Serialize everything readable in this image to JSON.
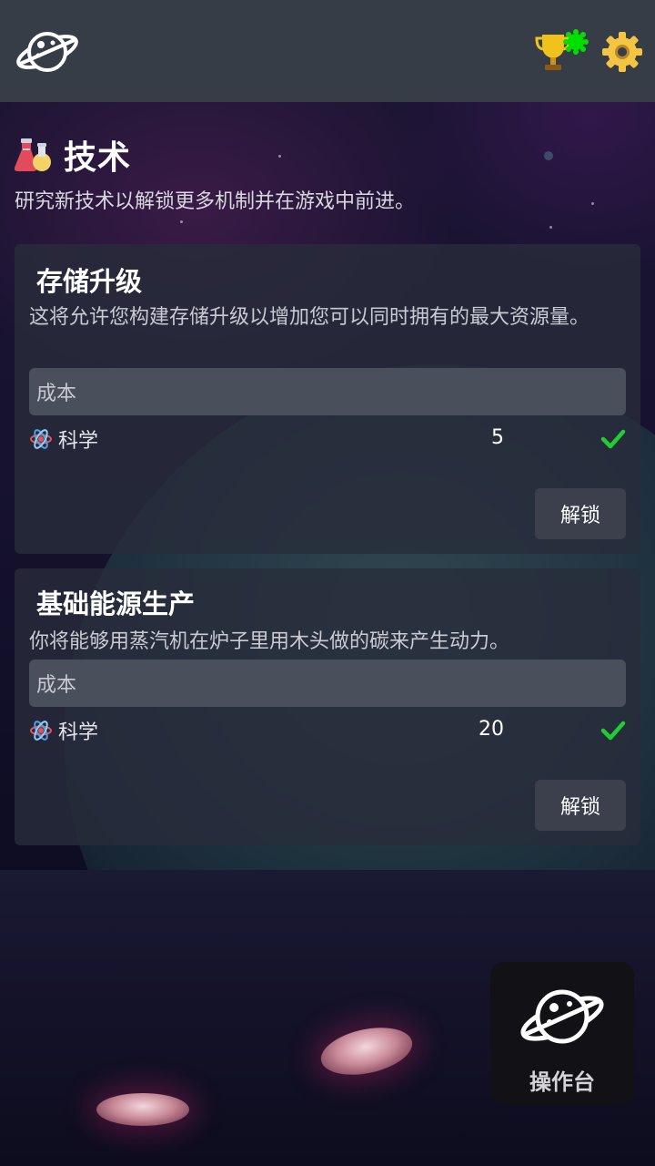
{
  "topbar": {
    "logo_icon": "planet-icon",
    "achievements_icon": "trophy-icon",
    "settings_icon": "gear-icon",
    "notification_color": "#00e000"
  },
  "page": {
    "title_icon": "flask-icon",
    "title": "技术",
    "subtitle": "研究新技术以解锁更多机制并在游戏中前进。"
  },
  "technologies": [
    {
      "title": "存储升级",
      "description": "这将允许您构建存储升级以增加您可以同时拥有的最大资源量。",
      "cost_label": "成本",
      "resource_icon": "atom-icon",
      "resource_name": "科学",
      "amount": "5",
      "affordable": true,
      "unlock_label": "解锁"
    },
    {
      "title": "基础能源生产",
      "description": "你将能够用蒸汽机在炉子里用木头做的碳来产生动力。",
      "cost_label": "成本",
      "resource_icon": "atom-icon",
      "resource_name": "科学",
      "amount": "20",
      "affordable": true,
      "unlock_label": "解锁"
    }
  ],
  "console": {
    "icon": "planet-icon",
    "label": "操作台"
  },
  "colors": {
    "topbar": "#373d47",
    "card": "#282c3a",
    "check": "#22cc33",
    "trophy": "#f1c21b",
    "gear": "#f4c542"
  }
}
